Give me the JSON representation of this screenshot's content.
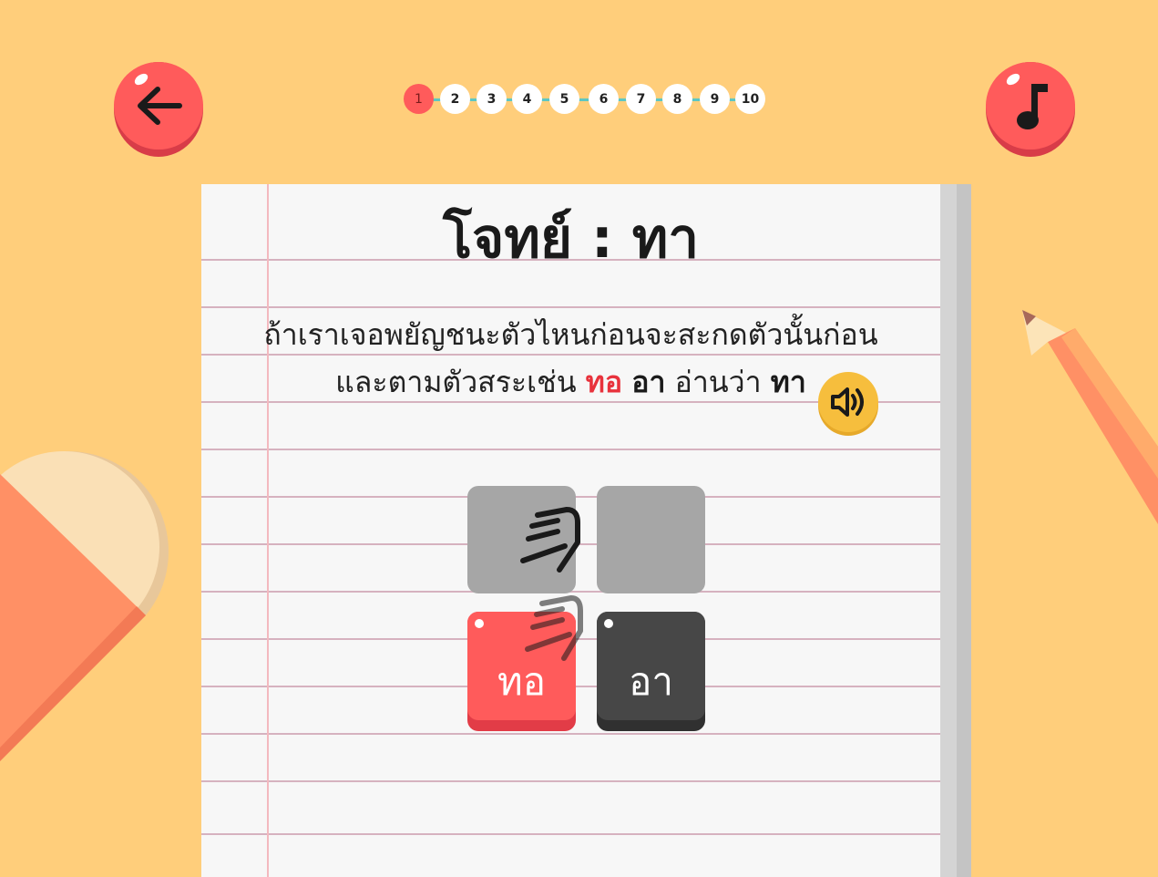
{
  "header": {
    "back_icon": "arrow-left-icon",
    "music_icon": "music-note-icon",
    "steps": [
      "1",
      "2",
      "3",
      "4",
      "5",
      "6",
      "7",
      "8",
      "9",
      "10"
    ],
    "active_step": 1
  },
  "lesson": {
    "title": "โจทย์ : ทา",
    "line1": "ถ้าเราเจอพยัญชนะตัวไหนก่อนจะสะกดตัวนั้นก่อน",
    "line2_prefix": "และตามตัวสระเช่น",
    "word1": "ทอ",
    "word2": "อา",
    "line2_mid": "อ่านว่า",
    "word3": "ทา",
    "speaker_icon": "speaker-icon"
  },
  "tiles": [
    {
      "label": "ทอ",
      "color": "#ff5b5b",
      "shade": "#e23c47"
    },
    {
      "label": "อา",
      "color": "#474747",
      "shade": "#303030"
    }
  ],
  "colors": {
    "background": "#ffce7b",
    "accent_red": "#ff5b5b",
    "progress_line": "#5ec6c2",
    "speaker": "#f6be3d"
  }
}
